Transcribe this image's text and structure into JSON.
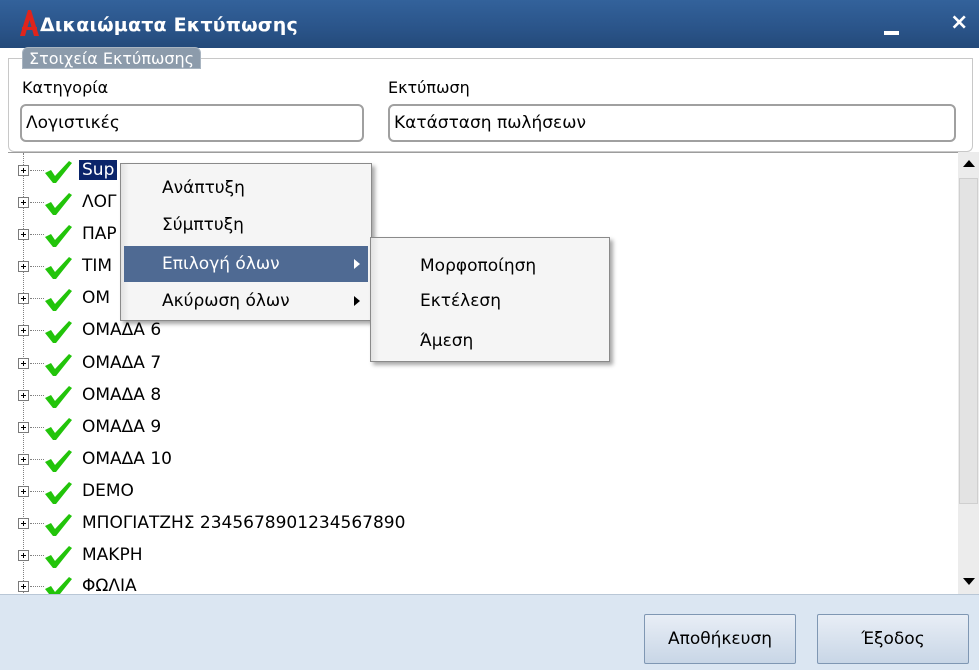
{
  "window": {
    "title": "Δικαιώματα Εκτύπωσης",
    "close_symbol": "×",
    "accent_color": "#2a5489"
  },
  "group": {
    "legend": "Στοιχεία Εκτύπωσης",
    "category_label": "Κατηγορία",
    "category_value": "Λογιστικές",
    "print_label": "Εκτύπωση",
    "print_value": "Κατάσταση πωλήσεων"
  },
  "tree": {
    "items": [
      {
        "label": "Sup",
        "checked": true,
        "selected": true
      },
      {
        "label": "ΛΟΓ",
        "checked": true
      },
      {
        "label": "ΠΑΡ",
        "checked": true
      },
      {
        "label": "ΤΙΜ",
        "checked": true
      },
      {
        "label": "ΟΜ",
        "checked": true
      },
      {
        "label": "ΟΜΑΔΑ 6",
        "checked": true
      },
      {
        "label": "ΟΜΑΔΑ 7",
        "checked": true
      },
      {
        "label": "ΟΜΑΔΑ 8",
        "checked": true
      },
      {
        "label": "ΟΜΑΔΑ 9",
        "checked": true
      },
      {
        "label": "ΟΜΑΔΑ 10",
        "checked": true
      },
      {
        "label": "DEMO",
        "checked": true
      },
      {
        "label": "ΜΠΟΓΙΑΤΖΗΣ 2345678901234567890",
        "checked": true
      },
      {
        "label": "ΜΑΚΡΗ",
        "checked": true
      },
      {
        "label": "ΦΩΛΙΑ",
        "checked": true
      }
    ],
    "check_color": "#22c40a"
  },
  "context_menu": {
    "items": [
      {
        "label": "Ανάπτυξη"
      },
      {
        "label": "Σύμπτυξη"
      },
      {
        "label": "Επιλογή όλων",
        "submenu": true,
        "highlighted": true
      },
      {
        "label": "Ακύρωση όλων",
        "submenu": true
      }
    ]
  },
  "submenu": {
    "items": [
      {
        "label": "Μορφοποίηση"
      },
      {
        "label": "Εκτέλεση"
      },
      {
        "label": "Άμεση"
      }
    ]
  },
  "buttons": {
    "save": "Αποθήκευση",
    "exit": "Έξοδος"
  }
}
